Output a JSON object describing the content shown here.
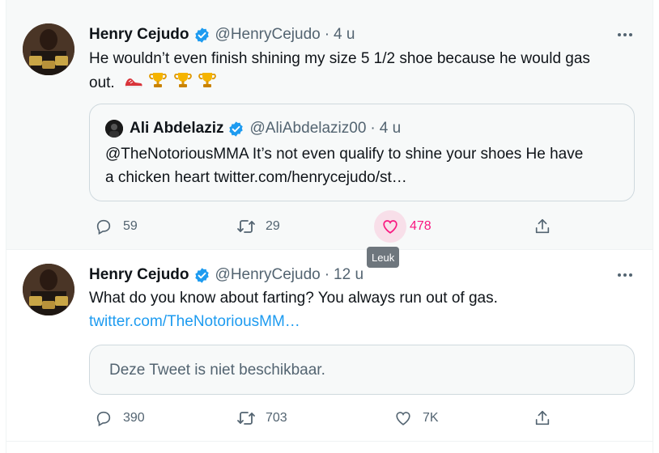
{
  "tweets": [
    {
      "author_name": "Henry Cejudo",
      "author_handle": "@HenryCejudo",
      "separator": "·",
      "time": "4 u",
      "text_line1": "He wouldn’t even finish shining my size 5 1/2 shoe because he would  gas",
      "text_line2": "out.",
      "emojis": [
        "shoe-icon",
        "trophy-icon",
        "trophy-icon",
        "trophy-icon"
      ],
      "quote": {
        "author_name": "Ali Abdelaziz",
        "author_handle": "@AliAbdelaziz00",
        "separator": "·",
        "time": "4 u",
        "text_line1": "@TheNotoriousMMA It’s not even qualify to shine your shoes He  have",
        "text_line2": "a chicken heart twitter.com/henrycejudo/st…"
      },
      "reply_count": "59",
      "retweet_count": "29",
      "like_count": "478",
      "liked": true
    },
    {
      "author_name": "Henry Cejudo",
      "author_handle": "@HenryCejudo",
      "separator": "·",
      "time": "12 u",
      "text_line1": "What do you know about farting? You always run out of gas.",
      "link": "twitter.com/TheNotoriousMM…",
      "unavailable": "Deze Tweet is niet beschikbaar.",
      "reply_count": "390",
      "retweet_count": "703",
      "like_count": "7K"
    }
  ],
  "tooltip": "Leuk",
  "colors": {
    "accent": "#1d9bf0",
    "like": "#f91880",
    "secondary_text": "#536471",
    "hover_bg": "#f7f9f9"
  }
}
